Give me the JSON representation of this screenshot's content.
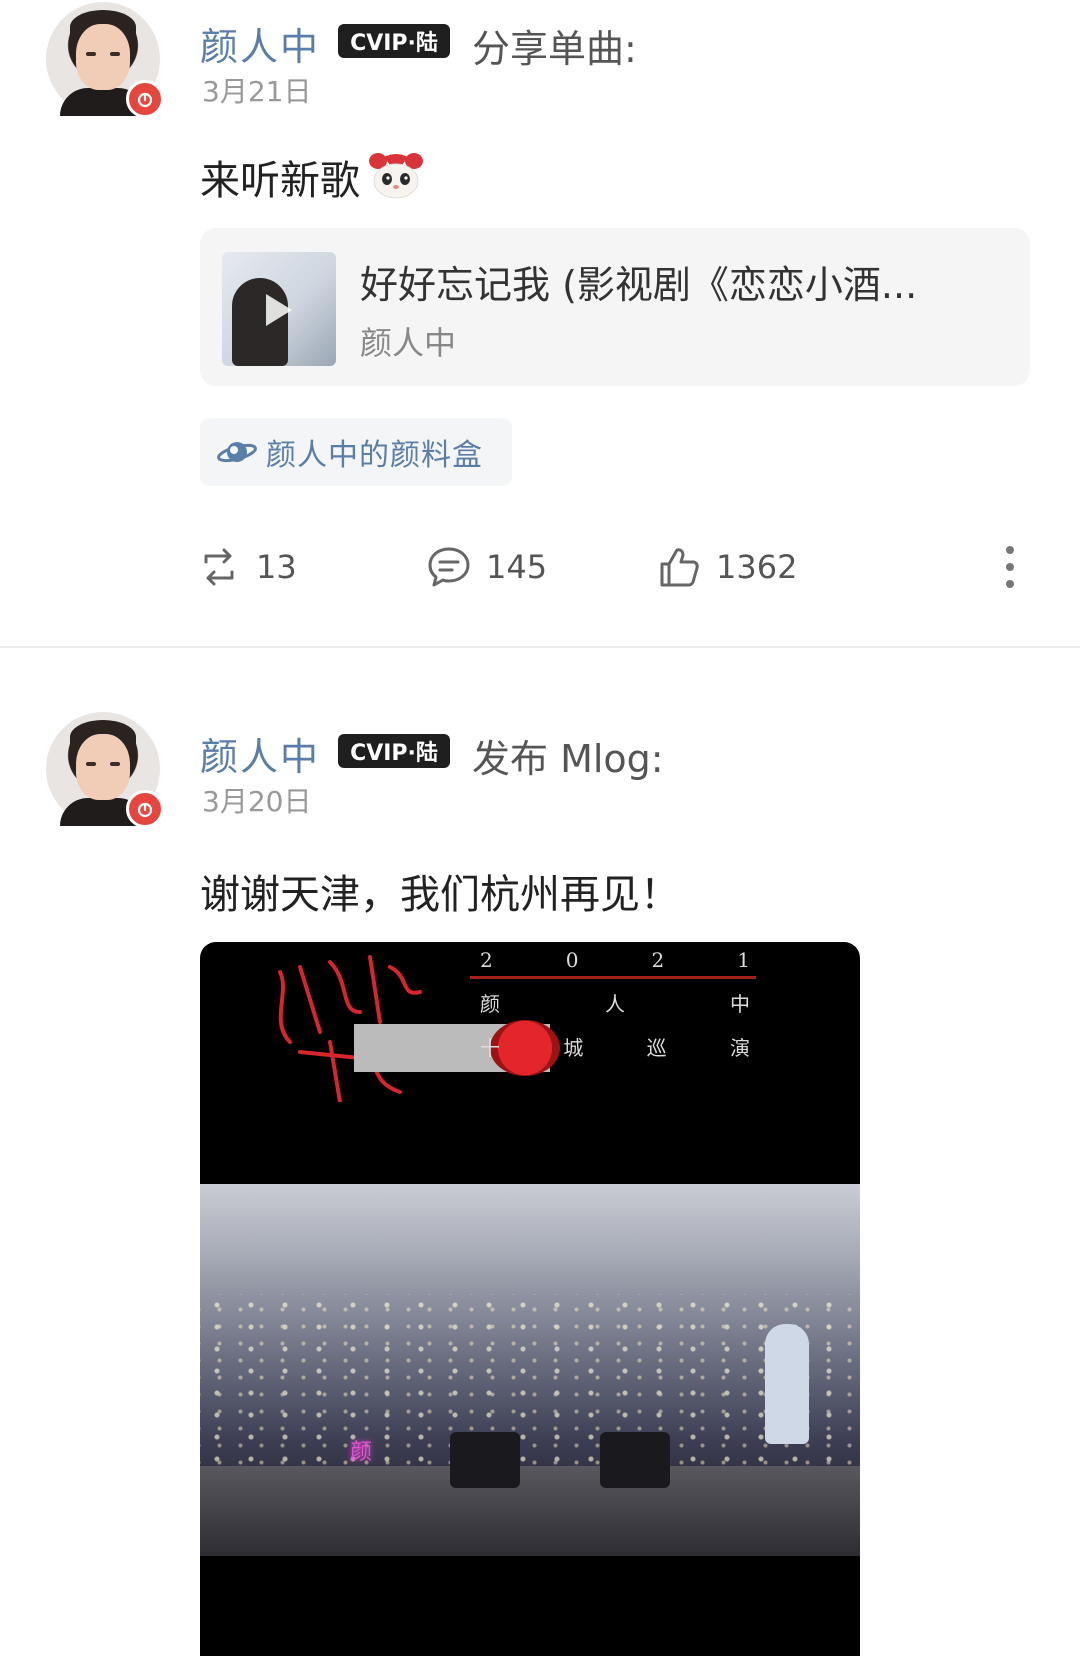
{
  "posts": [
    {
      "user_name": "颜人中",
      "vip_badge": "CVIP·陆",
      "action": "分享单曲:",
      "date": "3月21日",
      "text": "来听新歌",
      "song": {
        "title": "好好忘记我 (影视剧《恋恋小酒...",
        "artist": "颜人中"
      },
      "topic": "颜人中的颜料盒",
      "stats": {
        "repost": "13",
        "comment": "145",
        "like": "1362"
      }
    },
    {
      "user_name": "颜人中",
      "vip_badge": "CVIP·陆",
      "action": "发布 Mlog:",
      "date": "3月20日",
      "text": "谢谢天津，我们杭州再见！",
      "mlog": {
        "row1": [
          "2",
          "0",
          "2",
          "1"
        ],
        "row2": [
          "颜",
          "人",
          "中"
        ],
        "row3": [
          "十",
          "城",
          "巡",
          "演"
        ],
        "neon": "颜"
      }
    }
  ],
  "colors": {
    "name": "#5b7ea8",
    "badge_red": "#e5473f",
    "vip_bg": "#1f1f1f"
  },
  "icons": {
    "repost": "repost-icon",
    "comment": "comment-icon",
    "like": "thumbs-up-icon",
    "more": "more-vertical-icon",
    "topic": "planet-icon",
    "badge": "netease-music-icon"
  }
}
